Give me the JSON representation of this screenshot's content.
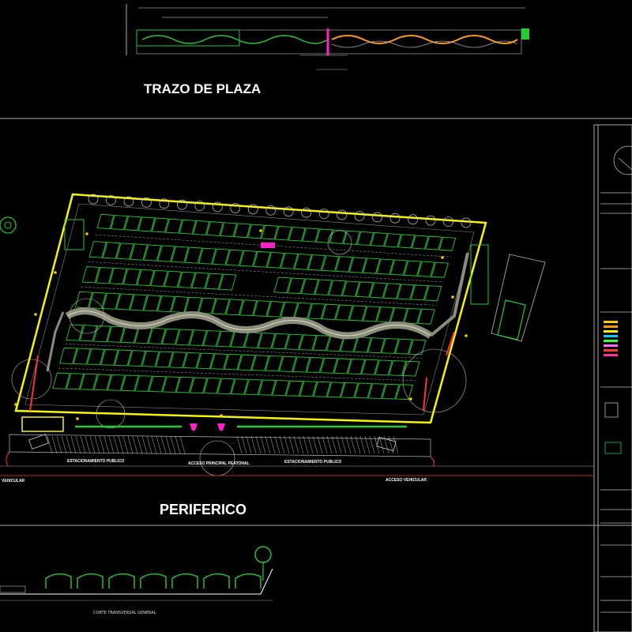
{
  "drawing": {
    "title_plaza": "TRAZO DE PLAZA",
    "title_road": "PERIFERICO",
    "label_section": "CORTE TRANSVERSAL GENERAL",
    "label_access_vehicular_left": "VEHICULAR",
    "label_access_vehicular_right": "ACCESO VEHICULAR",
    "label_parking_left": "ESTACIONAMIENTO PUBLICO",
    "label_parking_right": "ESTACIONAMIENTO PUBLICO",
    "label_main_access": "ACCESO PRINCIPAL PEATONAL"
  },
  "colors": {
    "background": "#000000",
    "stalls": "#22cc33",
    "boundary": "#f5f50a",
    "walkway": "#8c8c7a",
    "accent_magenta": "#ff22cc",
    "accent_red": "#ff3333",
    "orange": "#ff9922",
    "lines": "#dddddd"
  }
}
